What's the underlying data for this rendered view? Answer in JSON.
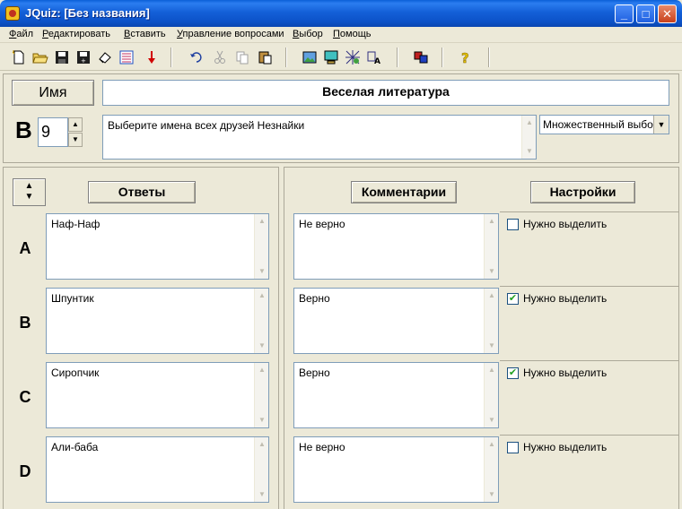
{
  "window": {
    "title": "JQuiz: [Без названия]"
  },
  "menu": [
    "Файл",
    "Редактировать",
    "Вставить",
    "Управление вопросами",
    "Выбор",
    "Помощь"
  ],
  "quiz": {
    "name_button": "Имя",
    "title": "Веселая литература",
    "question_letter": "В",
    "question_number": "9",
    "question_text": "Выберите имена всех друзей Незнайки",
    "question_type": "Множественный выбор"
  },
  "panels": {
    "answers_label": "Ответы",
    "comments_label": "Комментарии",
    "settings_label": "Настройки"
  },
  "answers": [
    {
      "letter": "A",
      "text": "Наф-Наф",
      "comment": "Не верно",
      "checkbox_label": "Нужно выделить",
      "checked": false
    },
    {
      "letter": "B",
      "text": "Шпунтик",
      "comment": "Верно",
      "checkbox_label": "Нужно выделить",
      "checked": true
    },
    {
      "letter": "C",
      "text": "Сиропчик",
      "comment": "Верно",
      "checkbox_label": "Нужно выделить",
      "checked": true
    },
    {
      "letter": "D",
      "text": "Али-баба",
      "comment": "Не верно",
      "checkbox_label": "Нужно выделить",
      "checked": false
    }
  ],
  "colors": {
    "titlebar": "#0c52c8",
    "face": "#ece9d8",
    "field_border": "#7f9db9",
    "check": "#21a121"
  }
}
